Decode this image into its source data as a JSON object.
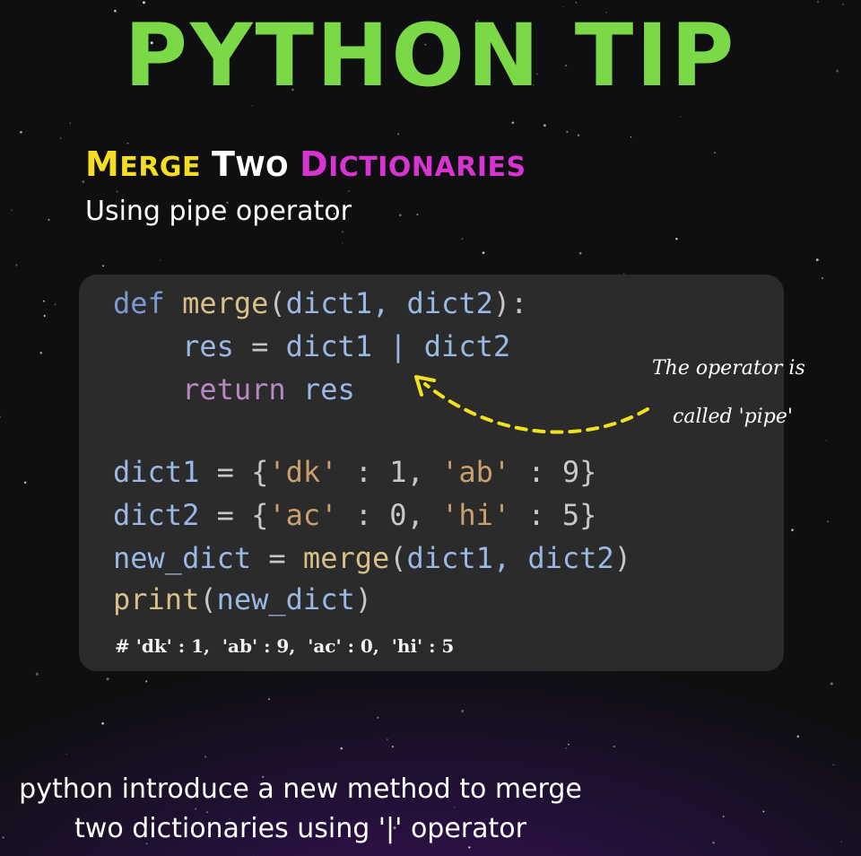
{
  "header": {
    "title": "PYTHON TIP",
    "subtitle": {
      "word1": {
        "cap": "M",
        "rest": "ERGE"
      },
      "word2": {
        "cap": "T",
        "rest": "WO"
      },
      "word3": {
        "cap": "D",
        "rest": "ICTIONARIES"
      }
    },
    "tagline": "Using pipe operator"
  },
  "code": {
    "line1": {
      "kw": "def",
      "fn": "merge",
      "open": "(",
      "args": "dict1, dict2",
      "close": "):"
    },
    "line2": {
      "var": "res",
      "assign": " = ",
      "expr": "dict1 | dict2"
    },
    "line3": {
      "kw": "return",
      "var": "res"
    },
    "line4": {
      "name": "dict1",
      "assign": " = {",
      "k1": "'dk'",
      "sep1": " : ",
      "v1": "1",
      "comma": ", ",
      "k2": "'ab'",
      "sep2": " : ",
      "v2": "9",
      "end": "}"
    },
    "line5": {
      "name": "dict2",
      "assign": " = {",
      "k1": "'ac'",
      "sep1": " : ",
      "v1": "0",
      "comma": ", ",
      "k2": "'hi'",
      "sep2": " : ",
      "v2": "5",
      "end": "}"
    },
    "line6": {
      "name": "new_dict",
      "assign": " = ",
      "fn": "merge",
      "open": "(",
      "args": "dict1, dict2",
      "close": ")"
    },
    "line7": {
      "fn": "print",
      "open": "(",
      "args": "new_dict",
      "close": ")"
    },
    "result": "# 'dk' : 1,  'ab' : 9,  'ac' : 0,  'hi' : 5"
  },
  "annotation": {
    "line1": "The operator is",
    "line2": "called 'pipe'"
  },
  "footer": {
    "line1": "python introduce a new method to merge",
    "line2": "two dictionaries using '|' operator"
  },
  "colors": {
    "title": "#7bd847",
    "merge": "#f5dd24",
    "two": "#ffffff",
    "dictionaries": "#d734d2",
    "panel": "#2b2b2b",
    "arrow": "#f0e020"
  }
}
